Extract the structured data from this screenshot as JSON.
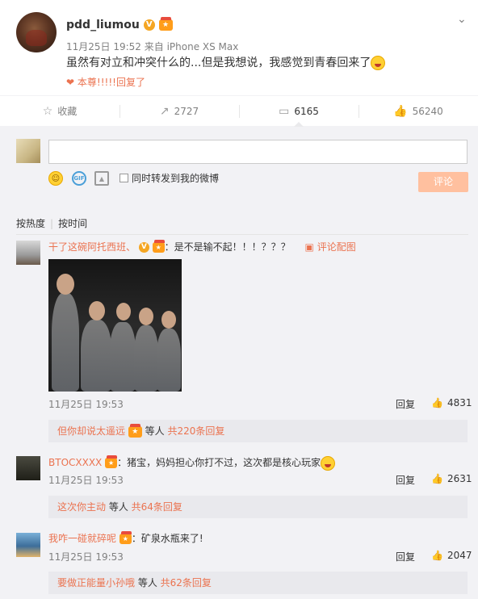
{
  "post": {
    "username": "pdd_liumou",
    "verified_badge": "V",
    "meta": "11月25日 19:52 来自 iPhone XS Max",
    "text": "虽然有对立和冲突什么的...但是我想说，我感觉到青春回来了",
    "liked_by": "本尊!!!!!回复了"
  },
  "actions": {
    "favorite": "收藏",
    "repost_count": "2727",
    "comment_count": "6165",
    "like_count": "56240"
  },
  "composer": {
    "forward_label": "同时转发到我的微博",
    "submit_label": "评论",
    "input_value": ""
  },
  "tabs": {
    "hot": "按热度",
    "time": "按时间"
  },
  "comments": [
    {
      "user": "干了这碗阿托西班、",
      "text": "：是不是输不起！！！？？？",
      "image_link": "评论配图",
      "time": "11月25日 19:53",
      "reply": "回复",
      "likes": "4831",
      "sub_user": "但你却说太遥远",
      "sub_mid": " 等人 ",
      "sub_count": "共220条回复"
    },
    {
      "user": "BTOCXXXX",
      "text": "：猪宝，妈妈担心你打不过，这次都是核心玩家",
      "time": "11月25日 19:53",
      "reply": "回复",
      "likes": "2631",
      "sub_user": "这次你主动",
      "sub_mid": " 等人 ",
      "sub_count": "共64条回复"
    },
    {
      "user": "我咋一碰就碎呢",
      "text": "：矿泉水瓶来了!",
      "time": "11月25日 19:53",
      "reply": "回复",
      "likes": "2047",
      "sub_user": "要做正能量小孙哦",
      "sub_mid": " 等人 ",
      "sub_count": "共62条回复"
    }
  ],
  "colors": {
    "accent": "#eb7350",
    "submit_bg": "#ffc09f",
    "comment_bg": "#f2f2f5"
  }
}
